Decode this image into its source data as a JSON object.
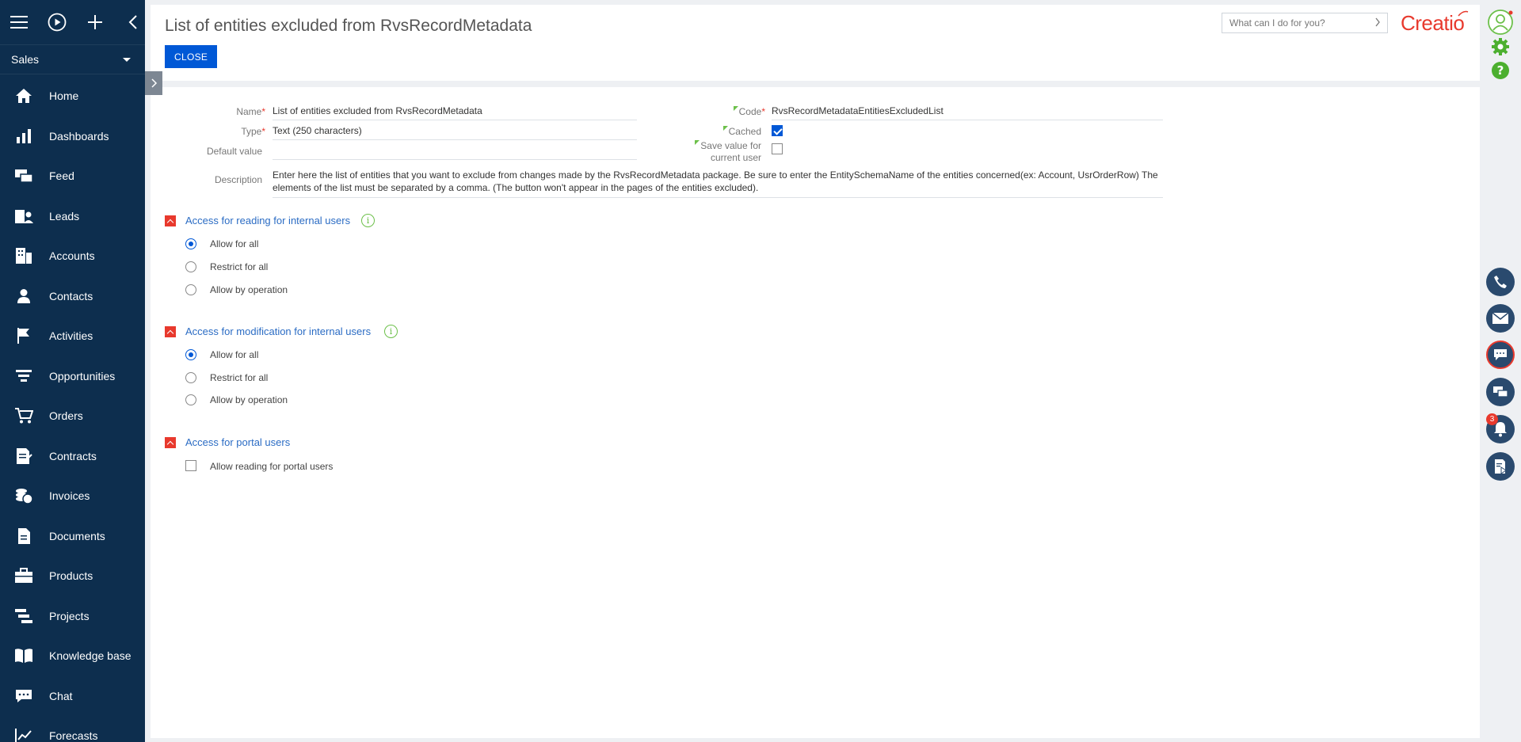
{
  "sidebar": {
    "section": "Sales",
    "items": [
      {
        "label": "Home",
        "icon": "home-icon"
      },
      {
        "label": "Dashboards",
        "icon": "bar-chart-icon"
      },
      {
        "label": "Feed",
        "icon": "feed-icon"
      },
      {
        "label": "Leads",
        "icon": "leads-icon"
      },
      {
        "label": "Accounts",
        "icon": "building-icon"
      },
      {
        "label": "Contacts",
        "icon": "person-icon"
      },
      {
        "label": "Activities",
        "icon": "flag-icon"
      },
      {
        "label": "Opportunities",
        "icon": "funnel-icon"
      },
      {
        "label": "Orders",
        "icon": "cart-icon"
      },
      {
        "label": "Contracts",
        "icon": "contract-icon"
      },
      {
        "label": "Invoices",
        "icon": "invoice-icon"
      },
      {
        "label": "Documents",
        "icon": "document-icon"
      },
      {
        "label": "Products",
        "icon": "briefcase-icon"
      },
      {
        "label": "Projects",
        "icon": "projects-icon"
      },
      {
        "label": "Knowledge base",
        "icon": "book-icon"
      },
      {
        "label": "Chat",
        "icon": "chat-icon"
      },
      {
        "label": "Forecasts",
        "icon": "forecast-icon"
      }
    ]
  },
  "header": {
    "title": "List of entities excluded from RvsRecordMetadata",
    "close_label": "CLOSE",
    "search_placeholder": "What can I do for you?",
    "logo": "Creatio"
  },
  "form": {
    "name_label": "Name",
    "name_value": "List of entities excluded from RvsRecordMetadata",
    "type_label": "Type",
    "type_value": "Text (250 characters)",
    "default_label": "Default value",
    "default_value": "",
    "description_label": "Description",
    "description_value": "Enter here the list of entities that you want to exclude from changes made by the RvsRecordMetadata package. Be sure to enter the EntitySchemaName of the entities concerned(ex: Account, UsrOrderRow) The elements of the list must be separated by a comma. (The button won't appear in the pages of the entities excluded).",
    "code_label": "Code",
    "code_value": "RvsRecordMetadataEntitiesExcludedList",
    "cached_label": "Cached",
    "cached": true,
    "save_label": "Save value for current user",
    "save_value": false
  },
  "groups": {
    "reading": {
      "title": "Access for reading for internal users",
      "options": [
        "Allow for all",
        "Restrict for all",
        "Allow by operation"
      ],
      "selected": "Allow for all"
    },
    "modification": {
      "title": "Access for modification for internal users",
      "options": [
        "Allow for all",
        "Restrict for all",
        "Allow by operation"
      ],
      "selected": "Allow for all"
    },
    "portal": {
      "title": "Access for portal users",
      "checkbox_label": "Allow reading for portal users",
      "checked": false
    }
  },
  "rail": {
    "notification_count": "3"
  },
  "colors": {
    "sidebar_bg": "#0d2e4e",
    "accent_blue": "#0058d6",
    "brand_red": "#e8392d",
    "link_blue": "#2b6cc4",
    "green": "#6cc04a"
  }
}
